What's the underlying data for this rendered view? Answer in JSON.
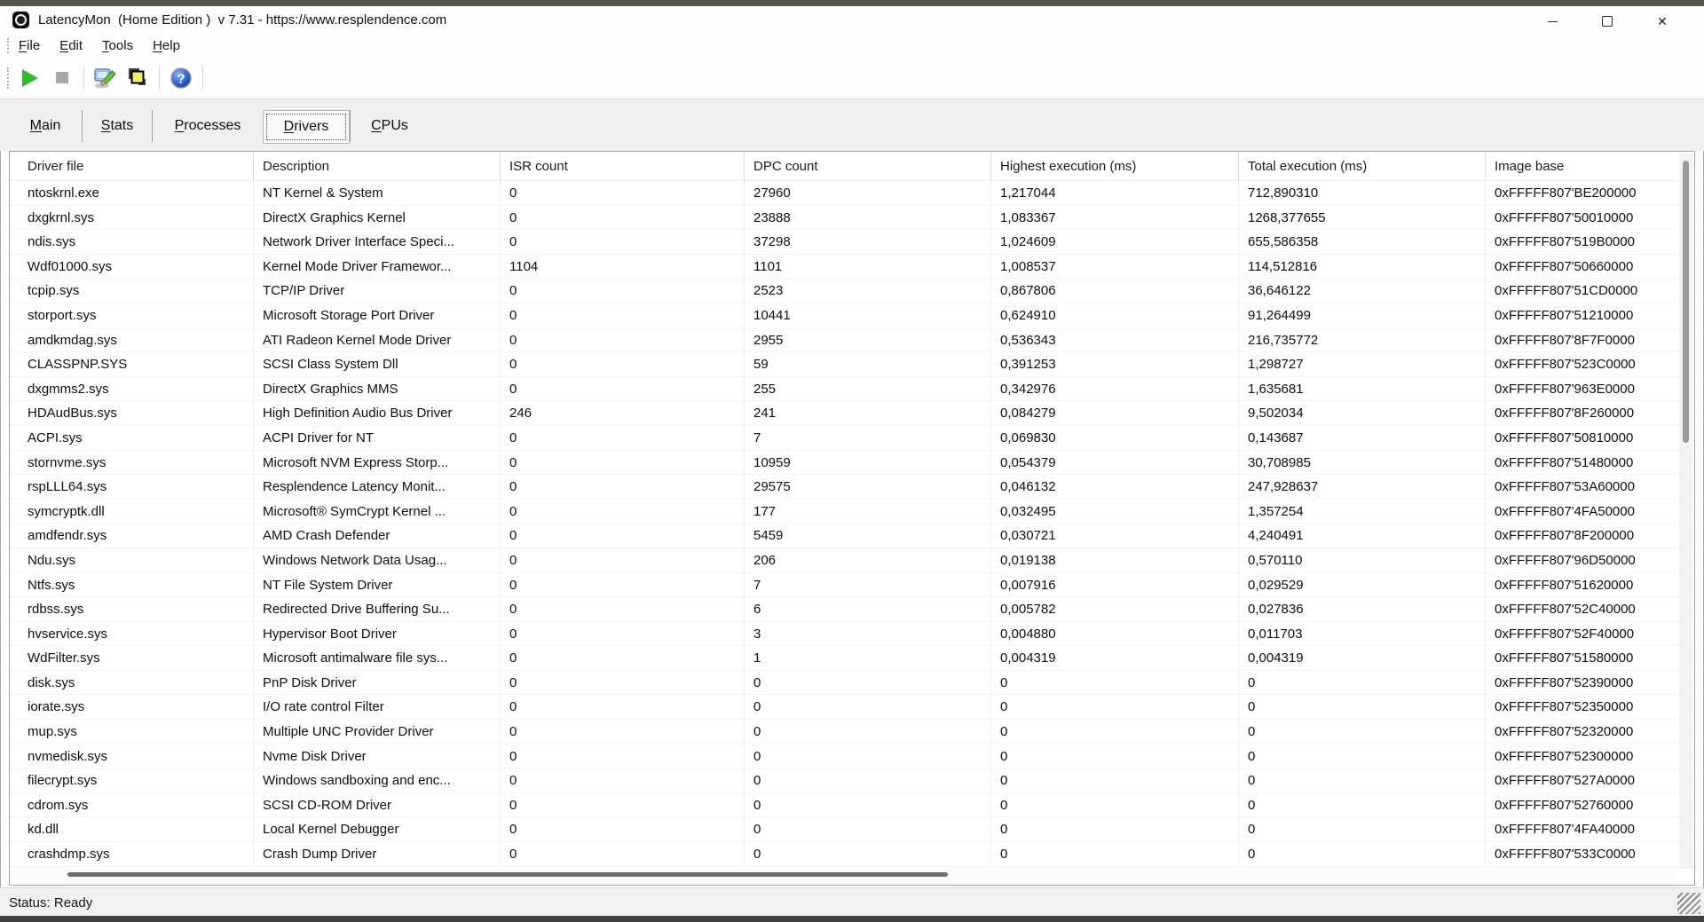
{
  "window": {
    "title": "LatencyMon  (Home Edition )  v 7.31 - https://www.resplendence.com",
    "close_glyph": "✕"
  },
  "menu": {
    "items": [
      {
        "accel": "F",
        "rest": "ile"
      },
      {
        "accel": "E",
        "rest": "dit"
      },
      {
        "accel": "T",
        "rest": "ools"
      },
      {
        "accel": "H",
        "rest": "elp"
      }
    ]
  },
  "toolbar": {
    "buttons": [
      {
        "name": "start-monitor",
        "icon": "play-icon"
      },
      {
        "name": "stop-monitor",
        "icon": "stop-icon"
      },
      {
        "name": "options",
        "icon": "monitor-pencil-icon"
      },
      {
        "name": "windows",
        "icon": "layered-windows-icon"
      },
      {
        "name": "help",
        "icon": "help-question-icon"
      }
    ]
  },
  "tabs": [
    {
      "accel": "M",
      "rest": "ain",
      "active": false
    },
    {
      "accel": "S",
      "rest": "tats",
      "active": false
    },
    {
      "accel": "P",
      "rest": "rocesses",
      "active": false
    },
    {
      "accel": "D",
      "rest": "rivers",
      "active": true
    },
    {
      "accel": "C",
      "rest": "PUs",
      "active": false
    }
  ],
  "table": {
    "columns": [
      "Driver file",
      "Description",
      "ISR count",
      "DPC count",
      "Highest execution (ms)",
      "Total execution (ms)",
      "Image base"
    ],
    "rows": [
      [
        "ntoskrnl.exe",
        "NT Kernel & System",
        "0",
        "27960",
        "1,217044",
        "712,890310",
        "0xFFFFF807'BE200000"
      ],
      [
        "dxgkrnl.sys",
        "DirectX Graphics Kernel",
        "0",
        "23888",
        "1,083367",
        "1268,377655",
        "0xFFFFF807'50010000"
      ],
      [
        "ndis.sys",
        "Network Driver Interface Speci...",
        "0",
        "37298",
        "1,024609",
        "655,586358",
        "0xFFFFF807'519B0000"
      ],
      [
        "Wdf01000.sys",
        "Kernel Mode Driver Framewor...",
        "1104",
        "1101",
        "1,008537",
        "114,512816",
        "0xFFFFF807'50660000"
      ],
      [
        "tcpip.sys",
        "TCP/IP Driver",
        "0",
        "2523",
        "0,867806",
        "36,646122",
        "0xFFFFF807'51CD0000"
      ],
      [
        "storport.sys",
        "Microsoft Storage Port Driver",
        "0",
        "10441",
        "0,624910",
        "91,264499",
        "0xFFFFF807'51210000"
      ],
      [
        "amdkmdag.sys",
        "ATI Radeon Kernel Mode Driver",
        "0",
        "2955",
        "0,536343",
        "216,735772",
        "0xFFFFF807'8F7F0000"
      ],
      [
        "CLASSPNP.SYS",
        "SCSI Class System Dll",
        "0",
        "59",
        "0,391253",
        "1,298727",
        "0xFFFFF807'523C0000"
      ],
      [
        "dxgmms2.sys",
        "DirectX Graphics MMS",
        "0",
        "255",
        "0,342976",
        "1,635681",
        "0xFFFFF807'963E0000"
      ],
      [
        "HDAudBus.sys",
        "High Definition Audio Bus Driver",
        "246",
        "241",
        "0,084279",
        "9,502034",
        "0xFFFFF807'8F260000"
      ],
      [
        "ACPI.sys",
        "ACPI Driver for NT",
        "0",
        "7",
        "0,069830",
        "0,143687",
        "0xFFFFF807'50810000"
      ],
      [
        "stornvme.sys",
        "Microsoft NVM Express Storp...",
        "0",
        "10959",
        "0,054379",
        "30,708985",
        "0xFFFFF807'51480000"
      ],
      [
        "rspLLL64.sys",
        "Resplendence Latency Monit...",
        "0",
        "29575",
        "0,046132",
        "247,928637",
        "0xFFFFF807'53A60000"
      ],
      [
        "symcryptk.dll",
        "Microsoft® SymCrypt Kernel ...",
        "0",
        "177",
        "0,032495",
        "1,357254",
        "0xFFFFF807'4FA50000"
      ],
      [
        "amdfendr.sys",
        "AMD Crash Defender",
        "0",
        "5459",
        "0,030721",
        "4,240491",
        "0xFFFFF807'8F200000"
      ],
      [
        "Ndu.sys",
        "Windows Network Data Usag...",
        "0",
        "206",
        "0,019138",
        "0,570110",
        "0xFFFFF807'96D50000"
      ],
      [
        "Ntfs.sys",
        "NT File System Driver",
        "0",
        "7",
        "0,007916",
        "0,029529",
        "0xFFFFF807'51620000"
      ],
      [
        "rdbss.sys",
        "Redirected Drive Buffering Su...",
        "0",
        "6",
        "0,005782",
        "0,027836",
        "0xFFFFF807'52C40000"
      ],
      [
        "hvservice.sys",
        "Hypervisor Boot Driver",
        "0",
        "3",
        "0,004880",
        "0,011703",
        "0xFFFFF807'52F40000"
      ],
      [
        "WdFilter.sys",
        "Microsoft antimalware file sys...",
        "0",
        "1",
        "0,004319",
        "0,004319",
        "0xFFFFF807'51580000"
      ],
      [
        "disk.sys",
        "PnP Disk Driver",
        "0",
        "0",
        "0",
        "0",
        "0xFFFFF807'52390000"
      ],
      [
        "iorate.sys",
        "I/O rate control Filter",
        "0",
        "0",
        "0",
        "0",
        "0xFFFFF807'52350000"
      ],
      [
        "mup.sys",
        "Multiple UNC Provider Driver",
        "0",
        "0",
        "0",
        "0",
        "0xFFFFF807'52320000"
      ],
      [
        "nvmedisk.sys",
        "Nvme Disk Driver",
        "0",
        "0",
        "0",
        "0",
        "0xFFFFF807'52300000"
      ],
      [
        "filecrypt.sys",
        "Windows sandboxing and enc...",
        "0",
        "0",
        "0",
        "0",
        "0xFFFFF807'527A0000"
      ],
      [
        "cdrom.sys",
        "SCSI CD-ROM Driver",
        "0",
        "0",
        "0",
        "0",
        "0xFFFFF807'52760000"
      ],
      [
        "kd.dll",
        "Local Kernel Debugger",
        "0",
        "0",
        "0",
        "0",
        "0xFFFFF807'4FA40000"
      ],
      [
        "crashdmp.sys",
        "Crash Dump Driver",
        "0",
        "0",
        "0",
        "0",
        "0xFFFFF807'533C0000"
      ]
    ]
  },
  "status": {
    "text": "Status: Ready"
  },
  "colors": {
    "play_green": "#2fba2f",
    "layers_yellow": "#f2ee70",
    "help_blue": "#2b62cf",
    "tabstrip_gray": "#f0f0f0"
  }
}
